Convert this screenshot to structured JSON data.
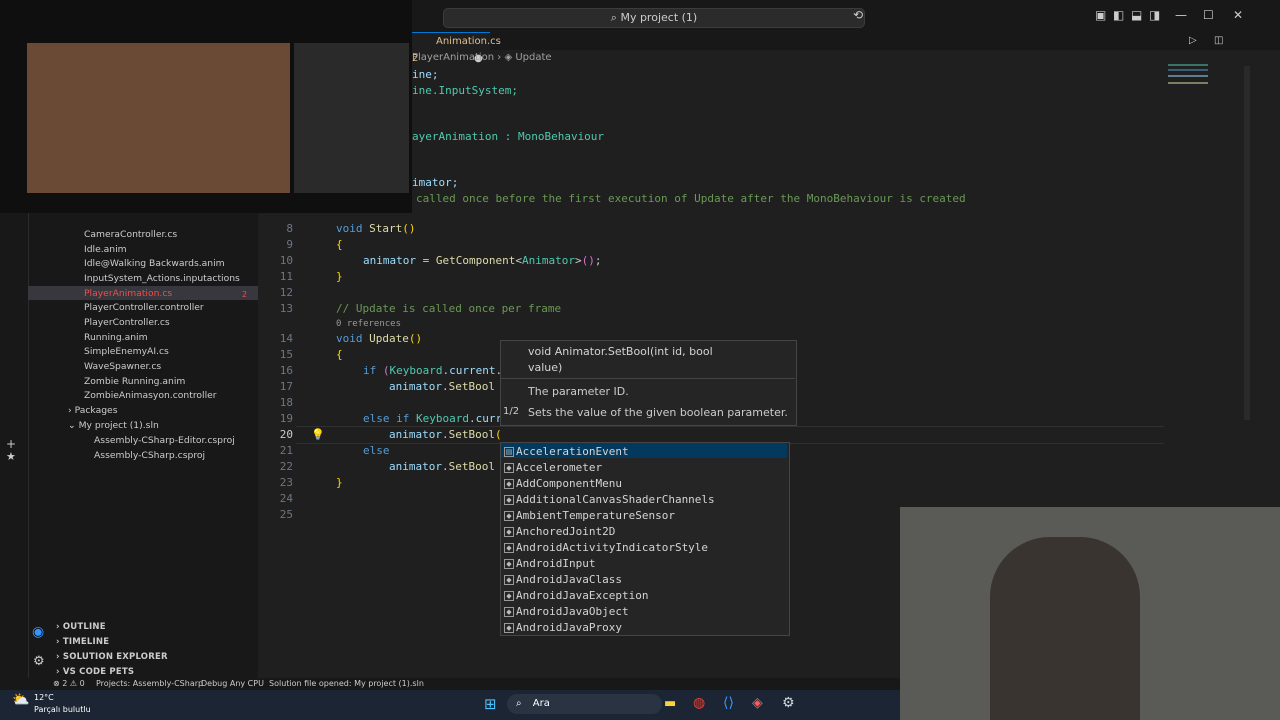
{
  "window": {
    "title": "My project (1)"
  },
  "tab": {
    "label": "Animation.cs 2"
  },
  "breadcrumb": {
    "part1": "PlayerAnimation",
    "part2": "Update"
  },
  "sidebar": {
    "files": [
      "CameraController.cs",
      "Idle.anim",
      "Idle@Walking Backwards.anim",
      "InputSystem_Actions.inputactions",
      "PlayerAnimation.cs",
      "PlayerController.controller",
      "PlayerController.cs",
      "Running.anim",
      "SimpleEnemyAI.cs",
      "WaveSpawner.cs",
      "Zombie Running.anim",
      "ZombieAnimasyon.controller"
    ],
    "active_badge": "2",
    "packages": "Packages",
    "solution": "My project (1).sln",
    "projects": [
      "Assembly-CSharp-Editor.csproj",
      "Assembly-CSharp.csproj"
    ],
    "sections": [
      "OUTLINE",
      "TIMELINE",
      "SOLUTION EXPLORER",
      "VS CODE PETS"
    ]
  },
  "editor": {
    "top_lines": [
      "ine;",
      "ine.InputSystem;",
      "ayerAnimation : MonoBehaviour",
      "imator;",
      "called once before the first execution of Update after the MonoBehaviour is created"
    ],
    "line_numbers": [
      "8",
      "9",
      "10",
      "11",
      "12",
      "13",
      "14",
      "15",
      "16",
      "17",
      "18",
      "19",
      "20",
      "21",
      "22",
      "23",
      "24",
      "25"
    ],
    "comment_update": "// Update is called once per frame",
    "references": "0 references"
  },
  "hover": {
    "signature_line1": "void Animator.SetBool(int id, bool",
    "signature_line2": "value)",
    "param": "The parameter ID.",
    "counter": "1/2",
    "description": "Sets the value of the given boolean parameter."
  },
  "suggestions": [
    "AccelerationEvent",
    "Accelerometer",
    "AddComponentMenu",
    "AdditionalCanvasShaderChannels",
    "AmbientTemperatureSensor",
    "AnchoredJoint2D",
    "AndroidActivityIndicatorStyle",
    "AndroidInput",
    "AndroidJavaClass",
    "AndroidJavaException",
    "AndroidJavaObject",
    "AndroidJavaProxy"
  ],
  "statusbar": {
    "errors": "2",
    "warnings": "0",
    "project": "Projects: Assembly-CSharp",
    "config": "Debug Any CPU",
    "message": "Solution file opened: My project (1).sln"
  },
  "taskbar": {
    "temperature": "12°C",
    "weather": "Parçalı bulutlu",
    "search": "Ara"
  },
  "colors": {
    "accent": "#0078d4",
    "editor_bg": "#1f1f1f",
    "sidebar_bg": "#181818",
    "active_file": "#f14c4c"
  }
}
